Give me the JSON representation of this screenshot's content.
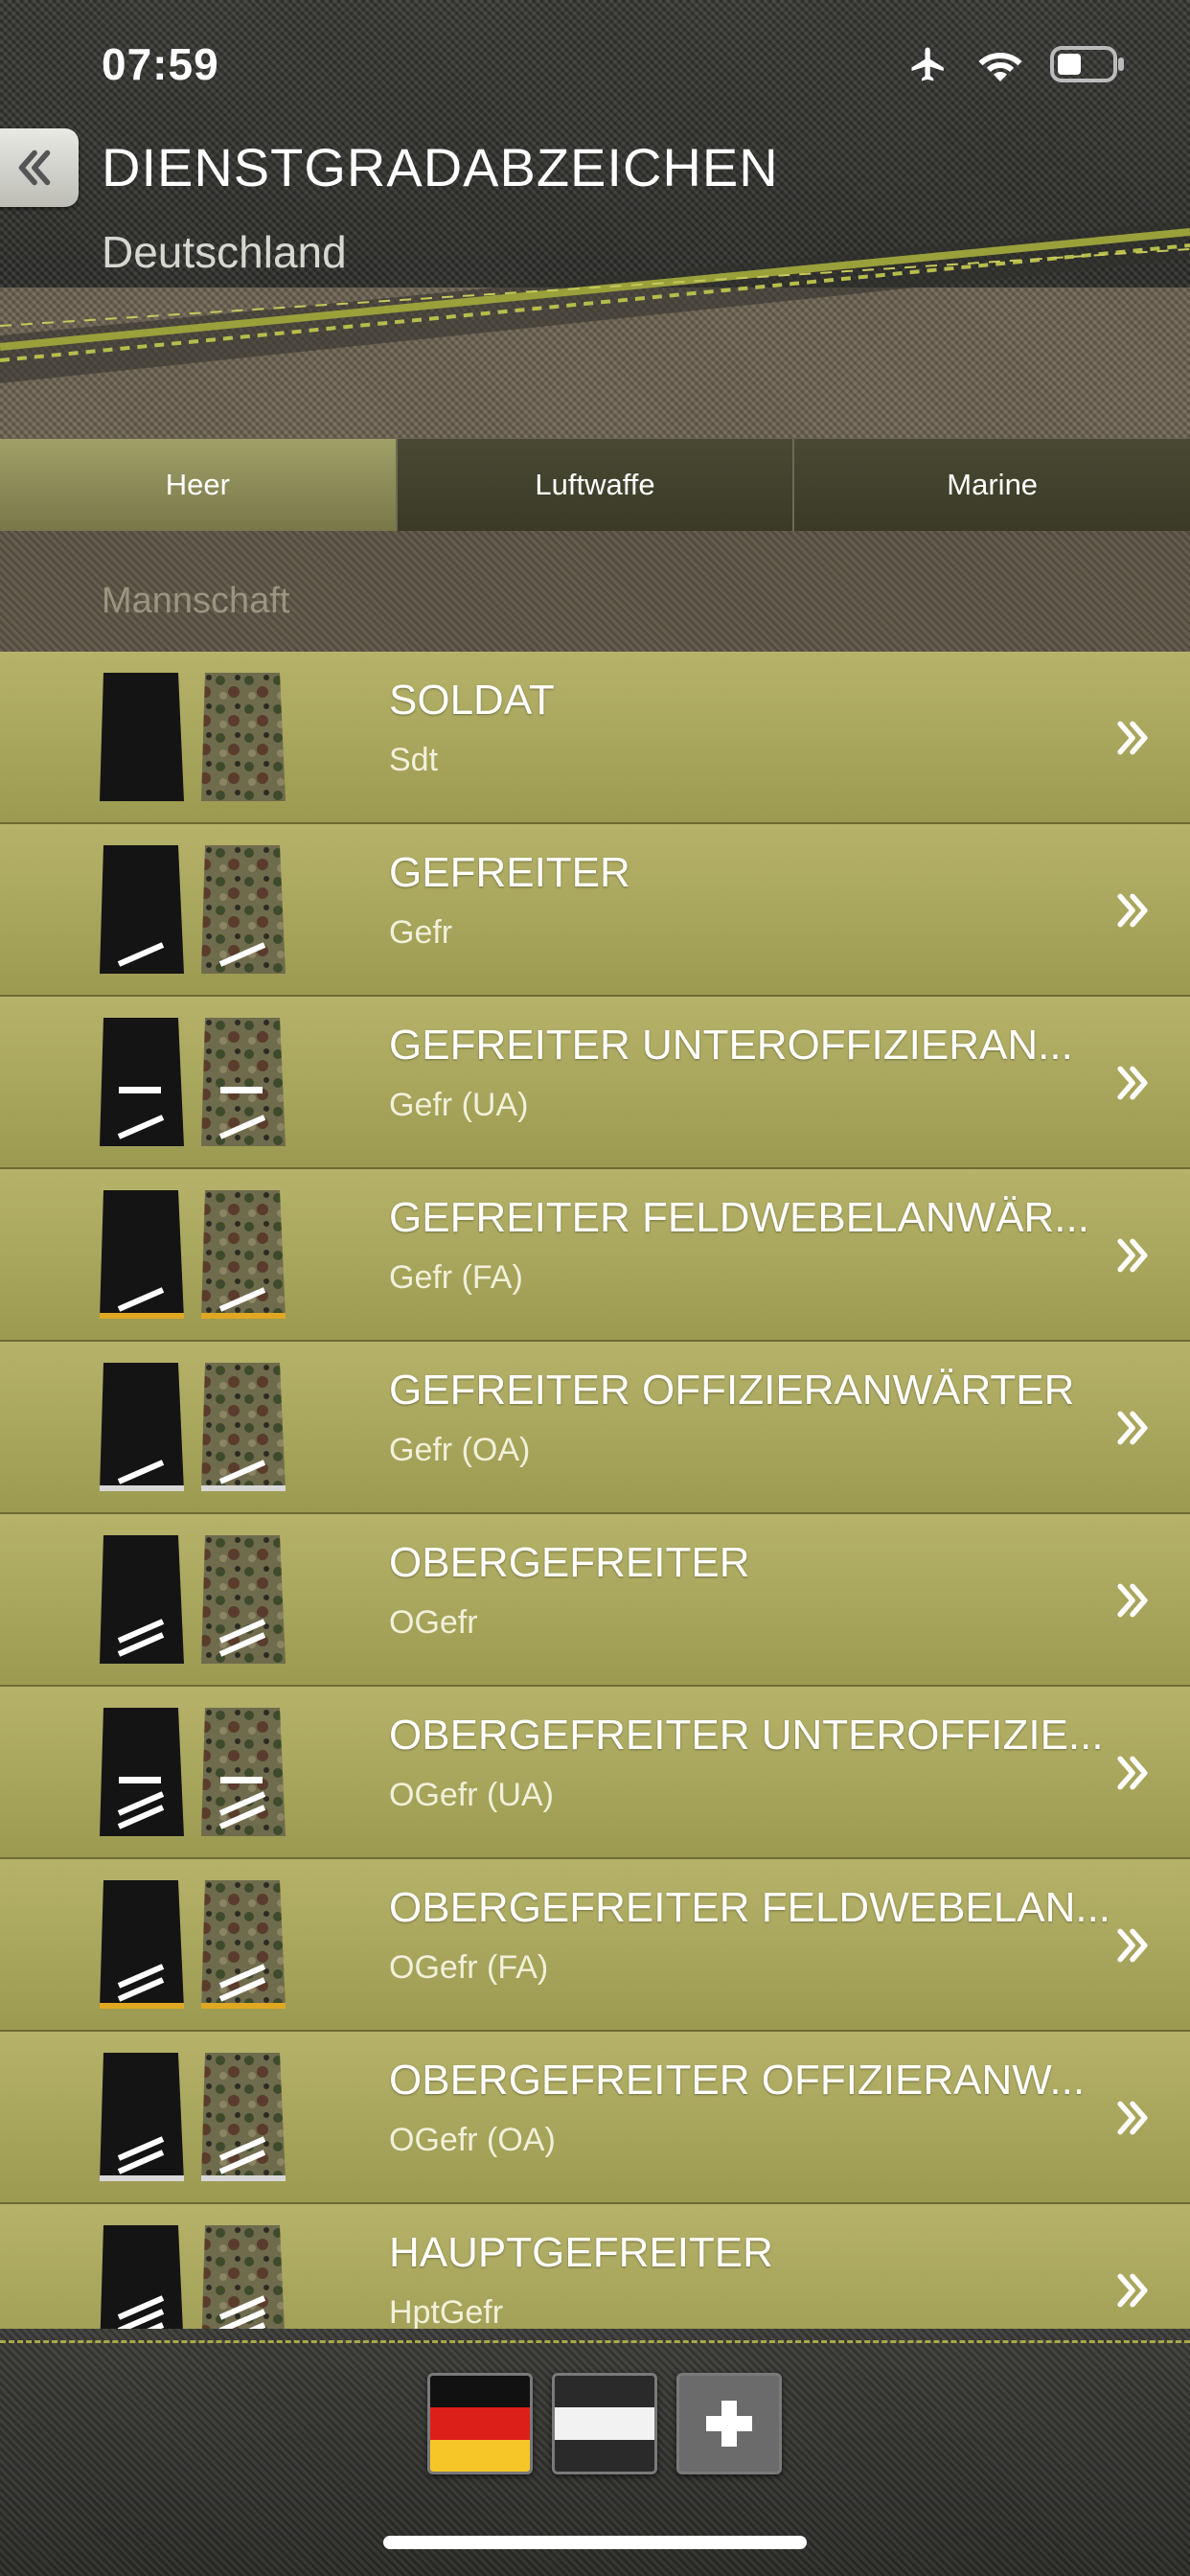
{
  "status_bar": {
    "time": "07:59"
  },
  "header": {
    "back_icon": "double-chevron-left-icon",
    "title": "DIENSTGRADABZEICHEN",
    "subtitle": "Deutschland"
  },
  "tabs": [
    {
      "label": "Heer",
      "active": true
    },
    {
      "label": "Luftwaffe",
      "active": false
    },
    {
      "label": "Marine",
      "active": false
    }
  ],
  "section": {
    "label": "Mannschaft"
  },
  "ranks": [
    {
      "name": "SOLDAT",
      "abbr": "Sdt",
      "stripes": 0,
      "bar": false,
      "edge": "none"
    },
    {
      "name": "GEFREITER",
      "abbr": "Gefr",
      "stripes": 1,
      "bar": false,
      "edge": "none"
    },
    {
      "name": "GEFREITER UNTEROFFIZIERAN...",
      "abbr": "Gefr (UA)",
      "stripes": 1,
      "bar": true,
      "edge": "none"
    },
    {
      "name": "GEFREITER FELDWEBELANWÄR...",
      "abbr": "Gefr (FA)",
      "stripes": 1,
      "bar": false,
      "edge": "gold"
    },
    {
      "name": "GEFREITER OFFIZIERANWÄRTER",
      "abbr": "Gefr (OA)",
      "stripes": 1,
      "bar": false,
      "edge": "silver"
    },
    {
      "name": "OBERGEFREITER",
      "abbr": "OGefr",
      "stripes": 2,
      "bar": false,
      "edge": "none"
    },
    {
      "name": "OBERGEFREITER UNTEROFFIZIE...",
      "abbr": "OGefr (UA)",
      "stripes": 2,
      "bar": true,
      "edge": "none"
    },
    {
      "name": "OBERGEFREITER FELDWEBELAN...",
      "abbr": "OGefr (FA)",
      "stripes": 2,
      "bar": false,
      "edge": "gold"
    },
    {
      "name": "OBERGEFREITER OFFIZIERANW...",
      "abbr": "OGefr (OA)",
      "stripes": 2,
      "bar": false,
      "edge": "silver"
    },
    {
      "name": "HAUPTGEFREITER",
      "abbr": "HptGefr",
      "stripes": 3,
      "bar": false,
      "edge": "none"
    }
  ],
  "bottom_bar": {
    "buttons": [
      "germany-flag-icon",
      "black-white-flag-icon",
      "plus-icon"
    ]
  },
  "colors": {
    "row_top": "#b6b26a",
    "row_bottom": "#9c9a50",
    "tab_active": "#8c8c58",
    "tab_inactive": "#3f3f2b",
    "gold_edge": "#e0a822",
    "silver_edge": "#d8d8d8"
  }
}
